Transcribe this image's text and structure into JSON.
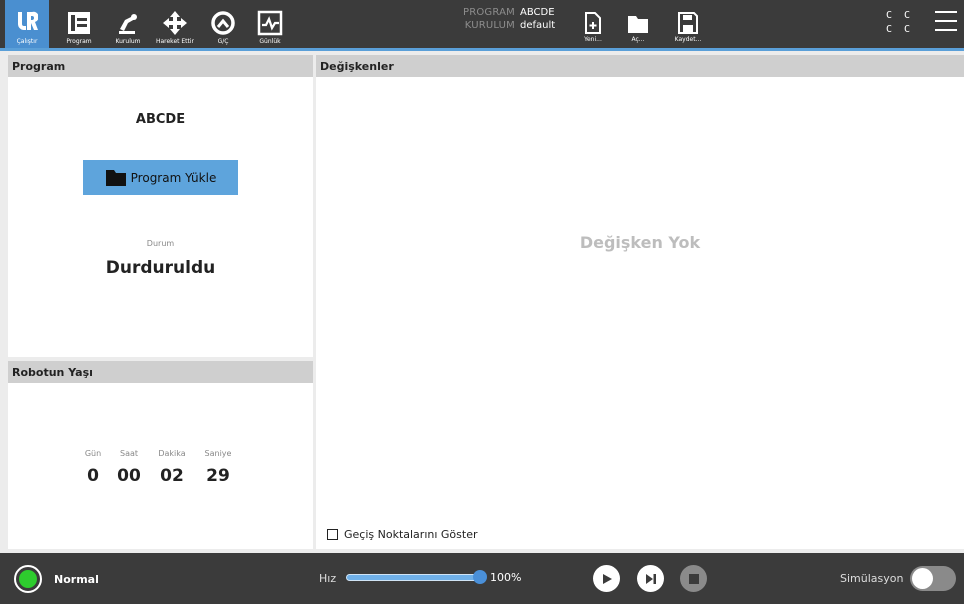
{
  "nav": {
    "items": [
      {
        "label": "Çalıştır",
        "icon": "ur-logo-icon"
      },
      {
        "label": "Program",
        "icon": "program-icon"
      },
      {
        "label": "Kurulum",
        "icon": "robot-arm-icon"
      },
      {
        "label": "Hareket Ettir",
        "icon": "move-arrows-icon"
      },
      {
        "label": "G/Ç",
        "icon": "io-icon"
      },
      {
        "label": "Günlük",
        "icon": "log-icon"
      }
    ]
  },
  "header": {
    "program_key": "PROGRAM",
    "program_value": "ABCDE",
    "installation_key": "KURULUM",
    "installation_value": "default",
    "new_label": "Yeni...",
    "open_label": "Aç...",
    "save_label": "Kaydet...",
    "cc_row1": "C C",
    "cc_row2": "C C"
  },
  "program_panel": {
    "title": "Program",
    "program_name": "ABCDE",
    "load_button": "Program Yükle",
    "status_label": "Durum",
    "status_value": "Durduruldu"
  },
  "age_panel": {
    "title": "Robotun Yaşı",
    "units": [
      {
        "label": "Gün",
        "value": "0"
      },
      {
        "label": "Saat",
        "value": "00"
      },
      {
        "label": "Dakika",
        "value": "02"
      },
      {
        "label": "Saniye",
        "value": "29"
      }
    ]
  },
  "vars_panel": {
    "title": "Değişkenler",
    "empty_text": "Değişken Yok",
    "waypoints_label": "Geçiş Noktalarını Göster",
    "waypoints_checked": false
  },
  "footer": {
    "mode": "Normal",
    "mode_color": "#2ecc2e",
    "speed_label": "Hız",
    "speed_value": "100%",
    "speed_fraction": 1.0,
    "simulation_label": "Simülasyon",
    "simulation_on": false
  },
  "colors": {
    "topbar": "#3b3b3b",
    "accent": "#4a8fd0",
    "load_button": "#5ea4dc"
  }
}
